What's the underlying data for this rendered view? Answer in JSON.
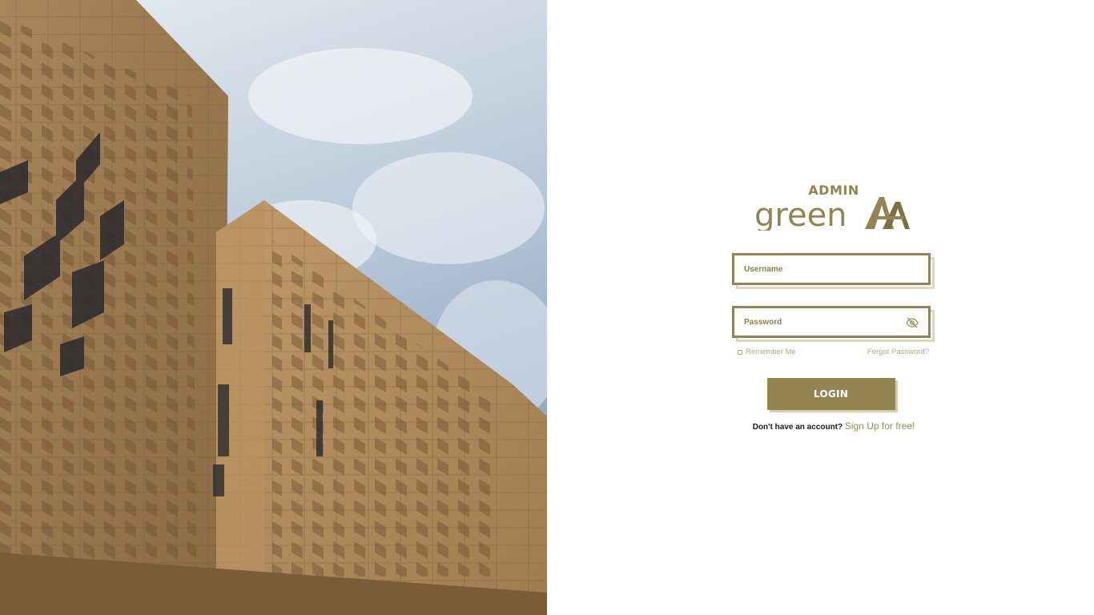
{
  "theme": {
    "accent": "#938451",
    "accent_light": "#b5aa7d"
  },
  "hero": {
    "image_description_icon": "building-photo"
  },
  "brand": {
    "admin_label": "ADMIN",
    "logo_text": "green",
    "logo_mark_icon": "double-a-logo-mark"
  },
  "form": {
    "username_placeholder": "Username",
    "password_placeholder": "Password",
    "password_toggle_icon": "eye-slash-icon",
    "remember_label": "Remember Me",
    "forgot_label": "Forgot Password?",
    "login_label": "LOGIN",
    "signup_prompt": "Don't have an account?",
    "signup_link": "Sign Up for free!"
  }
}
